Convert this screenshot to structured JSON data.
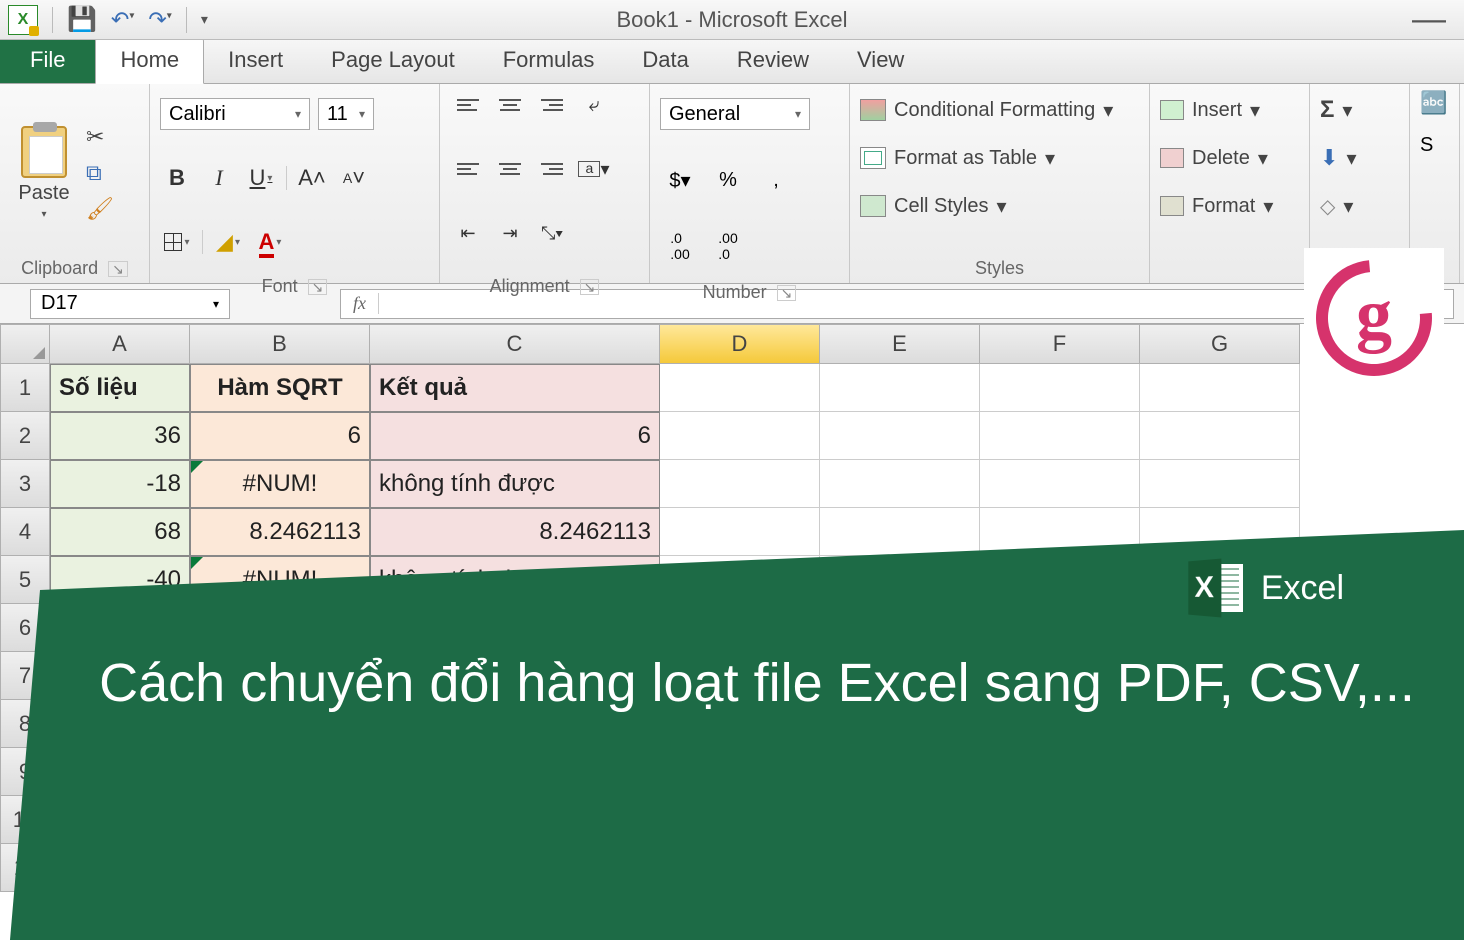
{
  "title": "Book1 - Microsoft Excel",
  "tabs": {
    "file": "File",
    "home": "Home",
    "insert": "Insert",
    "pagelayout": "Page Layout",
    "formulas": "Formulas",
    "data": "Data",
    "review": "Review",
    "view": "View"
  },
  "ribbon": {
    "clipboard": {
      "label": "Clipboard",
      "paste": "Paste"
    },
    "font": {
      "label": "Font",
      "name": "Calibri",
      "size": "11"
    },
    "alignment": {
      "label": "Alignment"
    },
    "number": {
      "label": "Number",
      "format": "General"
    },
    "styles": {
      "label": "Styles",
      "cf": "Conditional Formatting",
      "ft": "Format as Table",
      "cs": "Cell Styles"
    },
    "cells": {
      "ins": "Insert",
      "del": "Delete",
      "fmt": "Format"
    },
    "editing": {
      "sort": "S"
    }
  },
  "formulabar": {
    "namebox": "D17",
    "fx": "fx"
  },
  "columns": [
    "A",
    "B",
    "C",
    "D",
    "E",
    "F",
    "G"
  ],
  "sheet": {
    "headers": {
      "a": "Số liệu",
      "b": "Hàm SQRT",
      "c": "Kết quả"
    },
    "rows": [
      {
        "a": "36",
        "b": "6",
        "c": "6",
        "berr": false,
        "ctxt": false
      },
      {
        "a": "-18",
        "b": "#NUM!",
        "c": "không tính được",
        "berr": true,
        "ctxt": true
      },
      {
        "a": "68",
        "b": "8.2462113",
        "c": "8.2462113",
        "berr": false,
        "ctxt": false
      },
      {
        "a": "-40",
        "b": "#NUM!",
        "c": "không tính được",
        "berr": true,
        "ctxt": true
      }
    ]
  },
  "banner": {
    "text": "Cách chuyển đổi hàng loạt file Excel sang PDF, CSV,...",
    "logo": "Excel",
    "x": "X",
    "g": "g"
  }
}
